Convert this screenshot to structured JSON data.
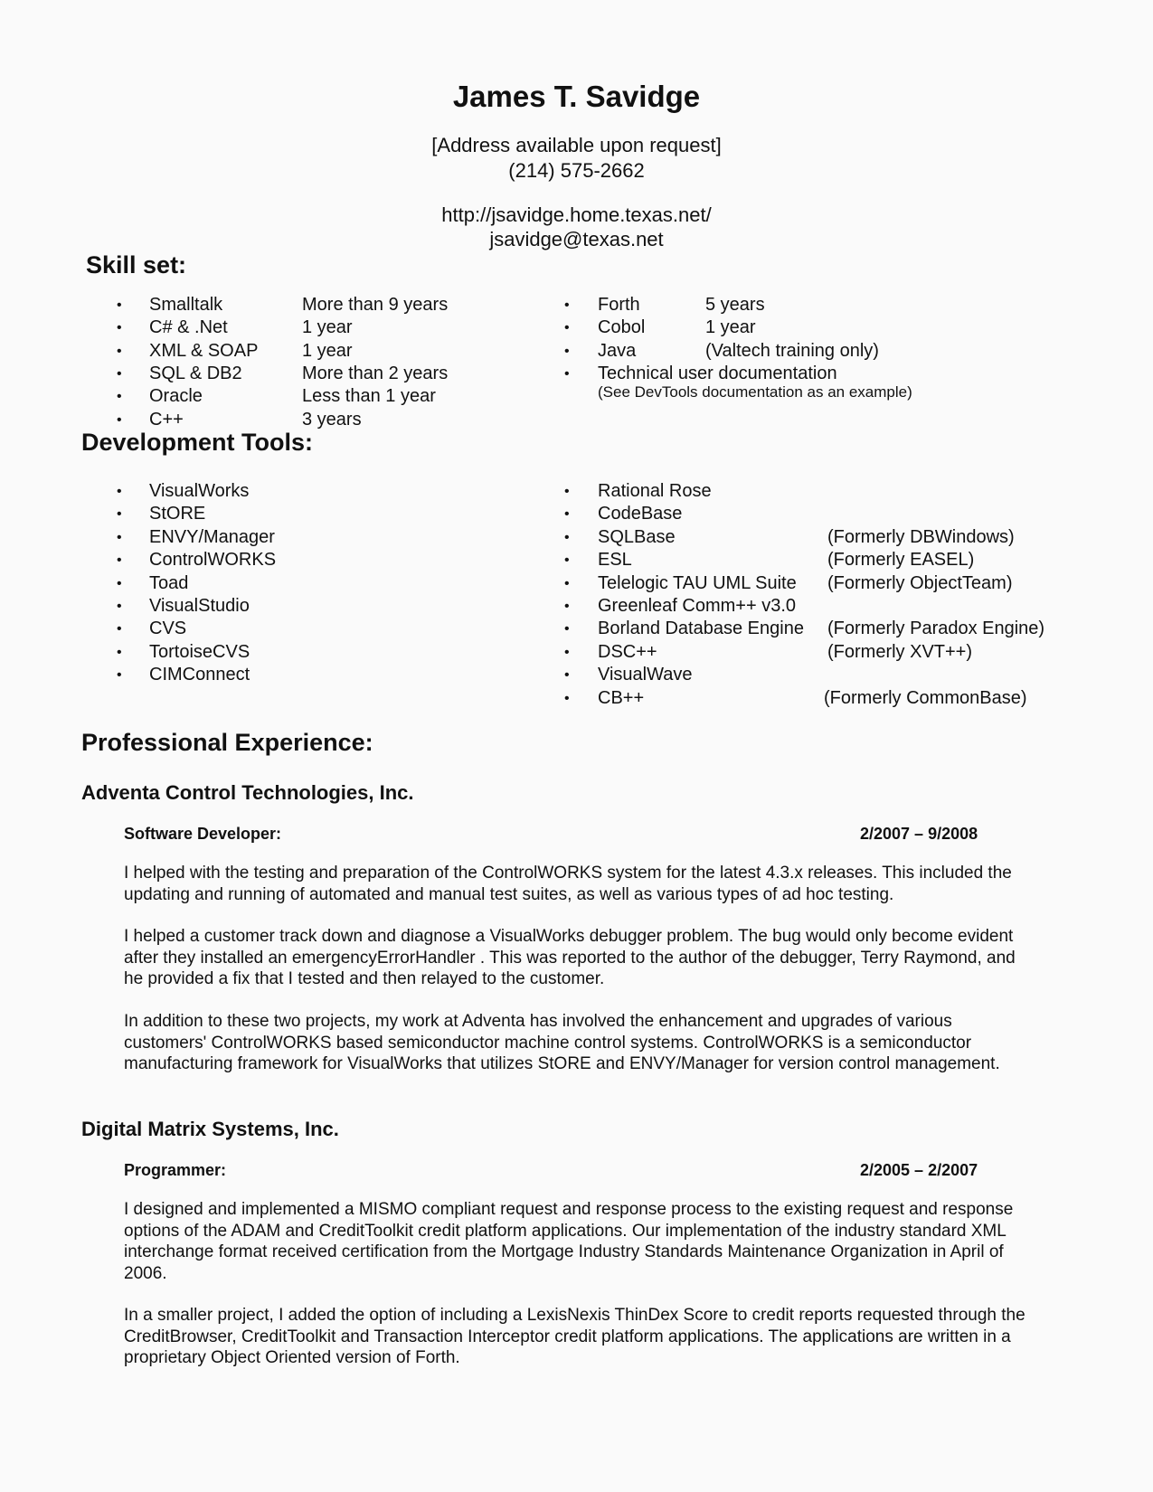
{
  "header": {
    "name": "James T. Savidge",
    "address": "[Address available upon request]",
    "phone": "(214) 575-2662",
    "website": "http://jsavidge.home.texas.net/",
    "email": "jsavidge@texas.net"
  },
  "skills": {
    "heading": "Skill set:",
    "left": [
      {
        "name": "Smalltalk",
        "detail": "More than 9 years"
      },
      {
        "name": "C# & .Net",
        "detail": "1 year"
      },
      {
        "name": "XML & SOAP",
        "detail": "1 year"
      },
      {
        "name": "SQL & DB2",
        "detail": "More than 2 years"
      },
      {
        "name": "Oracle",
        "detail": "Less than 1 year"
      },
      {
        "name": "C++",
        "detail": "3 years"
      }
    ],
    "right": [
      {
        "name": "Forth",
        "detail": "5 years"
      },
      {
        "name": "Cobol",
        "detail": "1 year"
      },
      {
        "name": "Java",
        "detail": "(Valtech training only)"
      },
      {
        "name": "Technical user documentation",
        "detail": ""
      }
    ],
    "note": "(See DevTools documentation as an example)"
  },
  "tools": {
    "heading": "Development Tools:",
    "left": [
      "VisualWorks",
      "StORE",
      "ENVY/Manager",
      "ControlWORKS",
      "Toad",
      "VisualStudio",
      "CVS",
      "TortoiseCVS",
      "CIMConnect"
    ],
    "right": [
      {
        "name": "Rational Rose",
        "note": ""
      },
      {
        "name": "CodeBase",
        "note": ""
      },
      {
        "name": "SQLBase",
        "note": "(Formerly DBWindows)"
      },
      {
        "name": "ESL",
        "note": "(Formerly EASEL)"
      },
      {
        "name": "Telelogic TAU UML Suite",
        "note": "(Formerly ObjectTeam)"
      },
      {
        "name": "Greenleaf Comm++ v3.0",
        "note": ""
      },
      {
        "name": "Borland Database Engine",
        "note": "(Formerly Paradox Engine)"
      },
      {
        "name": "DSC++",
        "note": "(Formerly XVT++)"
      },
      {
        "name": "VisualWave",
        "note": ""
      },
      {
        "name": "CB++",
        "note": "(Formerly CommonBase)"
      }
    ]
  },
  "experience": {
    "heading": "Professional Experience:",
    "jobs": [
      {
        "company": "Adventa Control Technologies, Inc.",
        "title": "Software Developer:",
        "dates": "2/2007 – 9/2008",
        "paragraphs": [
          "I helped with the testing and preparation of the ControlWORKS system for the latest 4.3.x releases. This included the updating and running of automated and manual test suites, as well as various types of ad hoc testing.",
          "I helped a customer track down and diagnose a VisualWorks debugger problem. The bug would only become evident after they installed an emergencyErrorHandler . This was reported to the author of the debugger, Terry Raymond, and he provided a fix that I tested and then relayed to the customer.",
          "In addition to these two projects, my work at Adventa has involved the enhancement and upgrades of various customers' ControlWORKS based semiconductor machine control systems. ControlWORKS is a semiconductor manufacturing framework for VisualWorks that utilizes StORE and ENVY/Manager for version control management."
        ]
      },
      {
        "company": "Digital Matrix Systems, Inc.",
        "title": "Programmer:",
        "dates": "2/2005 – 2/2007",
        "paragraphs": [
          "I designed and implemented a MISMO compliant request and response process to the existing request and response options of the ADAM and CreditToolkit credit platform applications. Our implementation of the industry standard XML interchange format received certification from the Mortgage Industry Standards Maintenance Organization in April of 2006.",
          "In a smaller project, I added the option of including a LexisNexis ThinDex Score to credit reports requested through the CreditBrowser, CreditToolkit and Transaction Interceptor credit platform applications. The applications are written in a proprietary Object Oriented version of Forth."
        ]
      }
    ]
  }
}
